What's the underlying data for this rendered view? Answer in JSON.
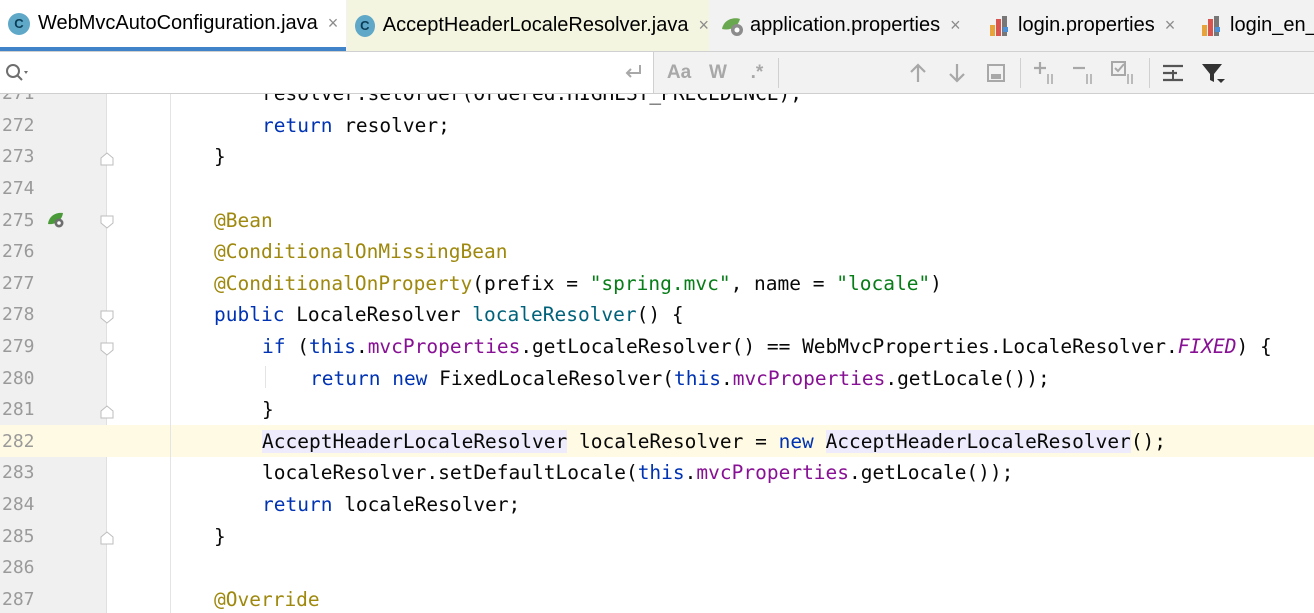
{
  "tabs": [
    {
      "label": "WebMvcAutoConfiguration.java",
      "icon": "java-class-icon",
      "close": "×"
    },
    {
      "label": "AcceptHeaderLocaleResolver.java",
      "icon": "java-class-icon",
      "close": "×"
    },
    {
      "label": "application.properties",
      "icon": "spring-properties-icon",
      "close": "×"
    },
    {
      "label": "login.properties",
      "icon": "properties-file-icon",
      "close": "×"
    },
    {
      "label": "login_en_U",
      "icon": "properties-file-icon"
    }
  ],
  "class_icon_letter": "C",
  "find_bar": {
    "search_value": "",
    "match_case_label": "Aa",
    "words_label": "W",
    "regex_label": ".*"
  },
  "colors": {
    "keyword": "#0033b3",
    "annotation": "#9e880d",
    "string": "#067d17",
    "field": "#871094",
    "method_decl": "#00627a",
    "active_tab_underline": "#4083c9",
    "current_line": "#fffae3"
  },
  "editor": {
    "line_numbers": [
      "271",
      "272",
      "273",
      "274",
      "275",
      "276",
      "277",
      "278",
      "279",
      "280",
      "281",
      "282",
      "283",
      "284",
      "285",
      "286",
      "287"
    ],
    "lines": {
      "l271": "resolver.setOrder(Ordered.HIGHEST_PRECEDENCE);",
      "l272_kw": "return",
      "l272_rest": " resolver;",
      "l273": "}",
      "l275": "@Bean",
      "l276": "@ConditionalOnMissingBean",
      "l277_ann": "@ConditionalOnProperty",
      "l277_a": "(prefix = ",
      "l277_s1": "\"spring.mvc\"",
      "l277_b": ", name = ",
      "l277_s2": "\"locale\"",
      "l277_c": ")",
      "l278_kw": "public",
      "l278_a": " LocaleResolver ",
      "l278_fn": "localeResolver",
      "l278_b": "() {",
      "l279_kw1": "if",
      "l279_a": " (",
      "l279_kw2": "this",
      "l279_dot": ".",
      "l279_fld": "mvcProperties",
      "l279_b": ".getLocaleResolver() == WebMvcProperties.LocaleResolver.",
      "l279_const": "FIXED",
      "l279_c": ") {",
      "l280_kw1": "return",
      "l280_sp": " ",
      "l280_kw2": "new",
      "l280_a": " FixedLocaleResolver(",
      "l280_kw3": "this",
      "l280_dot": ".",
      "l280_fld": "mvcProperties",
      "l280_b": ".getLocale());",
      "l281": "}",
      "l282_t1": "AcceptHeaderLocaleResolver",
      "l282_a": " localeResolver = ",
      "l282_kw": "new",
      "l282_sp": " ",
      "l282_t2": "AcceptHeaderLocaleResolver",
      "l282_b": "();",
      "l283_a": "localeResolver.setDefaultLocale(",
      "l283_kw": "this",
      "l283_dot": ".",
      "l283_fld": "mvcProperties",
      "l283_b": ".getLocale());",
      "l284_kw": "return",
      "l284_rest": " localeResolver;",
      "l285": "}",
      "l287": "@Override"
    }
  }
}
